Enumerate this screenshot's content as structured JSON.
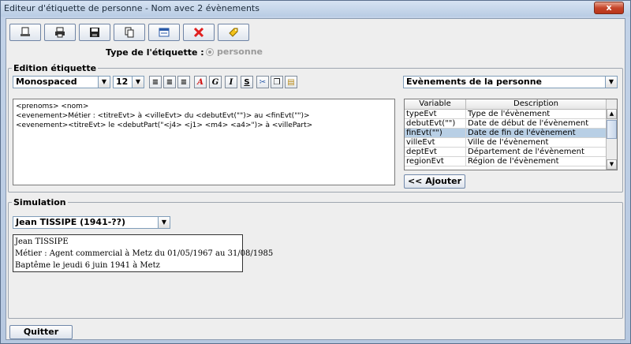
{
  "window": {
    "title": "Editeur d'étiquette de personne - Nom avec 2 évènements",
    "close": "x"
  },
  "toolbar": {
    "icons": [
      "print-preview-icon",
      "printer-icon",
      "save-icon",
      "copy-icon",
      "window-icon",
      "delete-icon",
      "label-icon"
    ]
  },
  "type": {
    "label": "Type de l'étiquette :",
    "option": "personne"
  },
  "edition": {
    "title": "Edition étiquette",
    "font": "Monospaced",
    "size": "12",
    "buttons": {
      "bold_italic_a": "A",
      "g": "G",
      "i": "I",
      "s": "S"
    },
    "lines": [
      "<prenoms> <nom>",
      "<evenement>Métier : <titreEvt> à <villeEvt> du <debutEvt(\"\")> au <finEvt(\"\")>",
      "<evenement><titreEvt> le <debutPart(\"<j4> <j1> <m4> <a4>\")> à <villePart>"
    ],
    "variables_combo": "Evènements de la personne",
    "table": {
      "headers": [
        "Variable",
        "Description"
      ],
      "rows": [
        {
          "var": "typeEvt",
          "desc": "Type de l'évènement"
        },
        {
          "var": "debutEvt(\"\")",
          "desc": "Date de début de l'évènement"
        },
        {
          "var": "finEvt(\"\")",
          "desc": "Date de fin de l'évènement"
        },
        {
          "var": "villeEvt",
          "desc": "Ville de l'évènement"
        },
        {
          "var": "deptEvt",
          "desc": "Département de l'évènement"
        },
        {
          "var": "regionEvt",
          "desc": "Région de l'évènement"
        }
      ]
    },
    "add_button": "<< Ajouter"
  },
  "simulation": {
    "title": "Simulation",
    "person": "Jean TISSIPE (1941-??)",
    "preview": [
      "Jean TISSIPE",
      "Métier : Agent commercial à Metz du 01/05/1967 au 31/08/1985",
      "Baptême le jeudi 6 juin 1941 à Metz"
    ]
  },
  "footer": {
    "quit": "Quitter"
  },
  "colors": {
    "selection": "#b8cfe5",
    "close": "#c6452a",
    "delete": "#e02020"
  }
}
